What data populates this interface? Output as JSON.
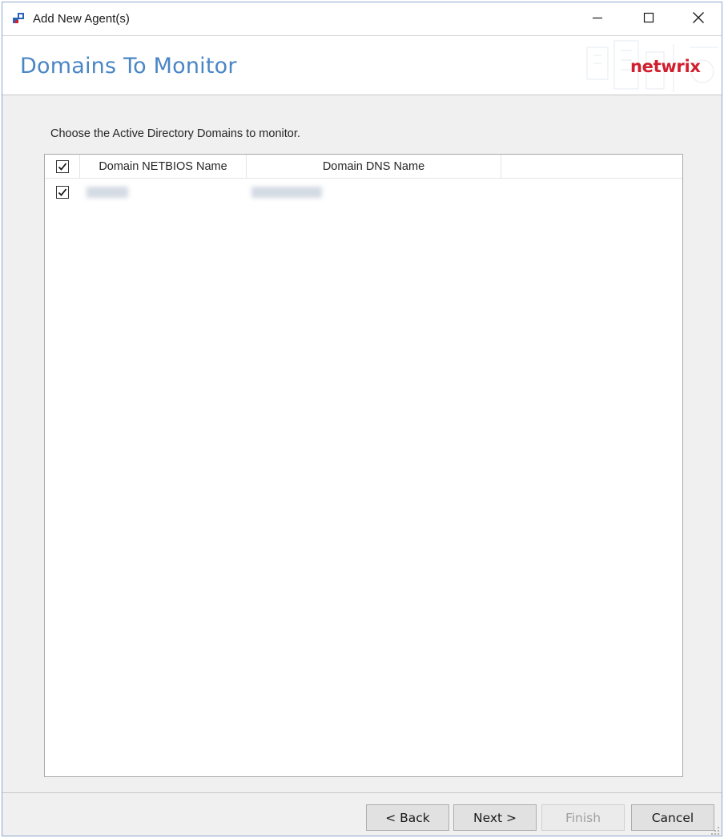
{
  "window": {
    "title": "Add New Agent(s)",
    "app_icon": "netwrix-app-icon",
    "controls": [
      "minimize-icon",
      "maximize-icon",
      "close-icon"
    ]
  },
  "header": {
    "title": "Domains To Monitor",
    "brand": "netwrix",
    "brand_color": "#d0202e",
    "title_color": "#4a86c5"
  },
  "instruction": "Choose the Active Directory Domains to monitor.",
  "domain_list": {
    "columns": [
      "Domain NETBIOS Name",
      "Domain DNS Name"
    ],
    "select_all_checked": true,
    "rows": [
      {
        "checked": true,
        "netbios": "",
        "dns": ""
      }
    ]
  },
  "buttons": {
    "back": "< Back",
    "next": "Next >",
    "finish": "Finish",
    "cancel": "Cancel"
  }
}
